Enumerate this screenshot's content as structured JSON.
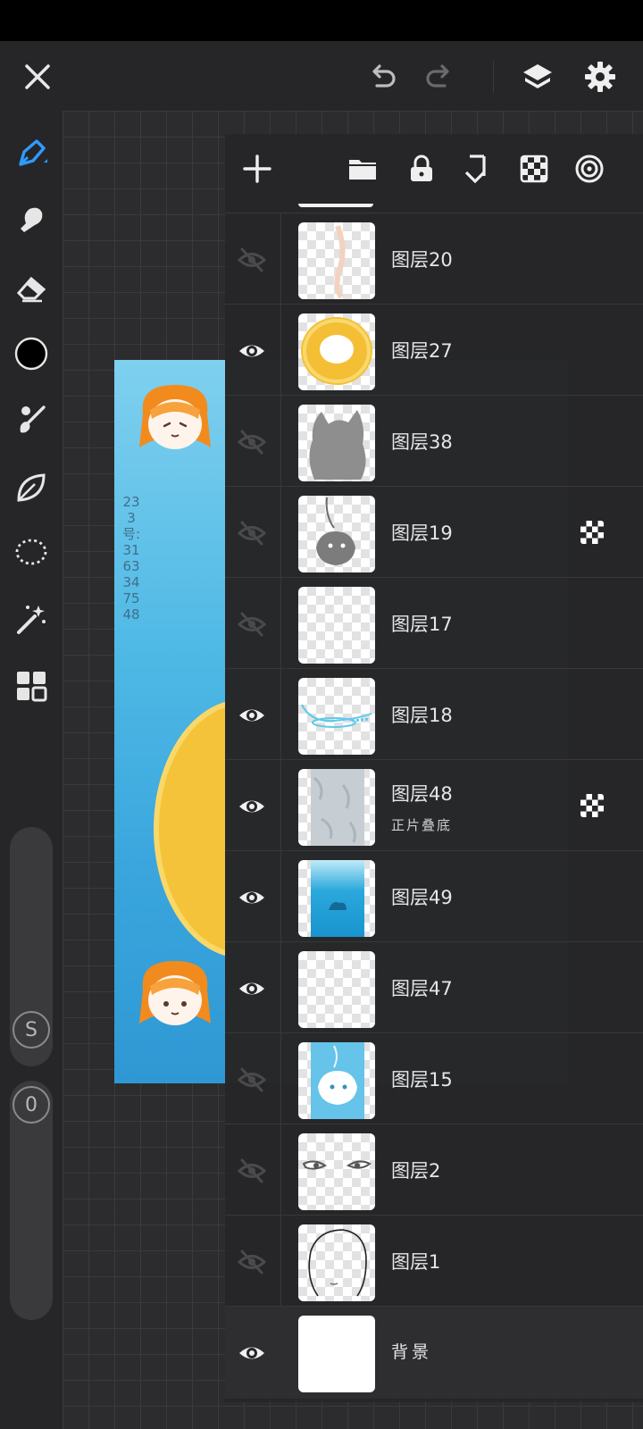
{
  "toolbar": {
    "close_icon": "close-icon",
    "undo_icon": "undo-icon",
    "redo_icon": "redo-icon",
    "layers_icon": "layers-icon",
    "settings_icon": "gear-icon"
  },
  "tools": [
    "pen-icon",
    "smudge-icon",
    "eraser-icon",
    "color-swatch",
    "brush-icon",
    "leaf-icon",
    "lasso-icon",
    "magic-wand-icon",
    "grid-icon"
  ],
  "current_color": "#000000",
  "sliders": {
    "size_label": "S",
    "opacity_label": "0"
  },
  "artwork": {
    "vertical_text": "233号:3163347548"
  },
  "layers_toolbar": [
    "add-layer-icon",
    "folder-icon",
    "lock-icon",
    "merge-down-icon",
    "transparency-icon",
    "blend-icon"
  ],
  "layers": [
    {
      "name": "图层20",
      "visible": false,
      "mode": "",
      "clipping": false
    },
    {
      "name": "图层27",
      "visible": true,
      "mode": "",
      "clipping": false
    },
    {
      "name": "图层38",
      "visible": false,
      "mode": "",
      "clipping": false
    },
    {
      "name": "图层19",
      "visible": false,
      "mode": "",
      "clipping": true
    },
    {
      "name": "图层17",
      "visible": false,
      "mode": "",
      "clipping": false
    },
    {
      "name": "图层18",
      "visible": true,
      "mode": "",
      "clipping": false
    },
    {
      "name": "图层48",
      "visible": true,
      "mode": "正片叠底",
      "clipping": true
    },
    {
      "name": "图层49",
      "visible": true,
      "mode": "",
      "clipping": false
    },
    {
      "name": "图层47",
      "visible": true,
      "mode": "",
      "clipping": false
    },
    {
      "name": "图层15",
      "visible": false,
      "mode": "",
      "clipping": false
    },
    {
      "name": "图层2",
      "visible": false,
      "mode": "",
      "clipping": false
    },
    {
      "name": "图层1",
      "visible": false,
      "mode": "",
      "clipping": false
    }
  ],
  "background_layer": {
    "name": "背景",
    "visible": true
  },
  "colors": {
    "accent": "#2f9bff",
    "panel": "#262628",
    "canvas_bg": "#2c2c2e"
  }
}
